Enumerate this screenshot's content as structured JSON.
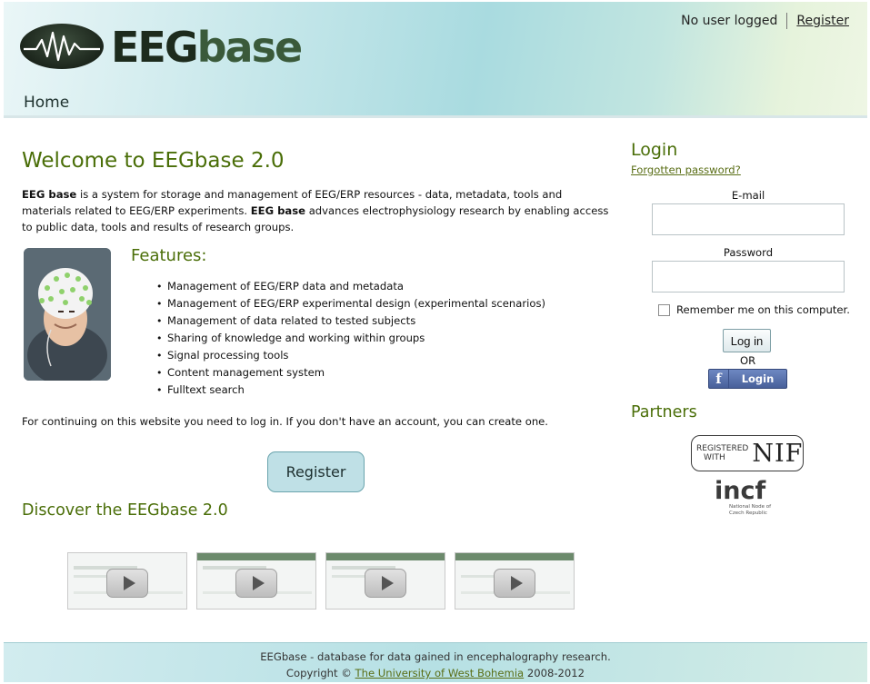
{
  "header": {
    "logo_text_dark": "EEG",
    "logo_text_light": "base",
    "user_status": "No user logged",
    "register_link": "Register",
    "nav_home": "Home"
  },
  "main": {
    "welcome_title": "Welcome to EEGbase 2.0",
    "intro": {
      "brand": "EEG base",
      "part1": " is a system for storage and management of EEG/ERP resources - data, metadata, tools and materials related to EEG/ERP experiments. ",
      "brand2": "EEG base",
      "part2": " advances electrophysiology research by enabling access to public data, tools and results of research groups."
    },
    "features_title": "Features:",
    "features": [
      "Management of EEG/ERP data and metadata",
      "Management of EEG/ERP experimental design (experimental scenarios)",
      "Management of data related to tested subjects",
      "Sharing of knowledge and working within groups",
      "Signal processing tools",
      "Content management system",
      "Fulltext search"
    ],
    "continue_text": "For continuing on this website you need to log in. If you don't have an account, you can create one.",
    "register_button": "Register",
    "discover_title": "Discover the EEGbase 2.0",
    "video_count": 4
  },
  "sidebar": {
    "login_title": "Login",
    "forgot_password": "Forgotten password?",
    "email_label": "E-mail",
    "email_value": "",
    "password_label": "Password",
    "password_value": "",
    "remember_label": "Remember me on this computer.",
    "remember_checked": false,
    "login_button": "Log in",
    "or_text": "OR",
    "facebook_button": "Login",
    "partners_title": "Partners",
    "nif_small_line1": "REGISTERED",
    "nif_small_line2": "WITH",
    "nif_big": "NIF",
    "incf_word": "incf",
    "incf_sub_line1": "National Node of",
    "incf_sub_line2": "Czech Republic"
  },
  "footer": {
    "line1": "EEGbase - database for data gained in encephalography research.",
    "copyright_prefix": "Copyright © ",
    "university_link": "The University of West Bohemia",
    "years": " 2008-2012"
  },
  "colors": {
    "heading_green": "#4a6e08",
    "link_green": "#5a6e16",
    "register_button_bg": "#bfe0e6",
    "facebook_blue": "#48609a"
  }
}
